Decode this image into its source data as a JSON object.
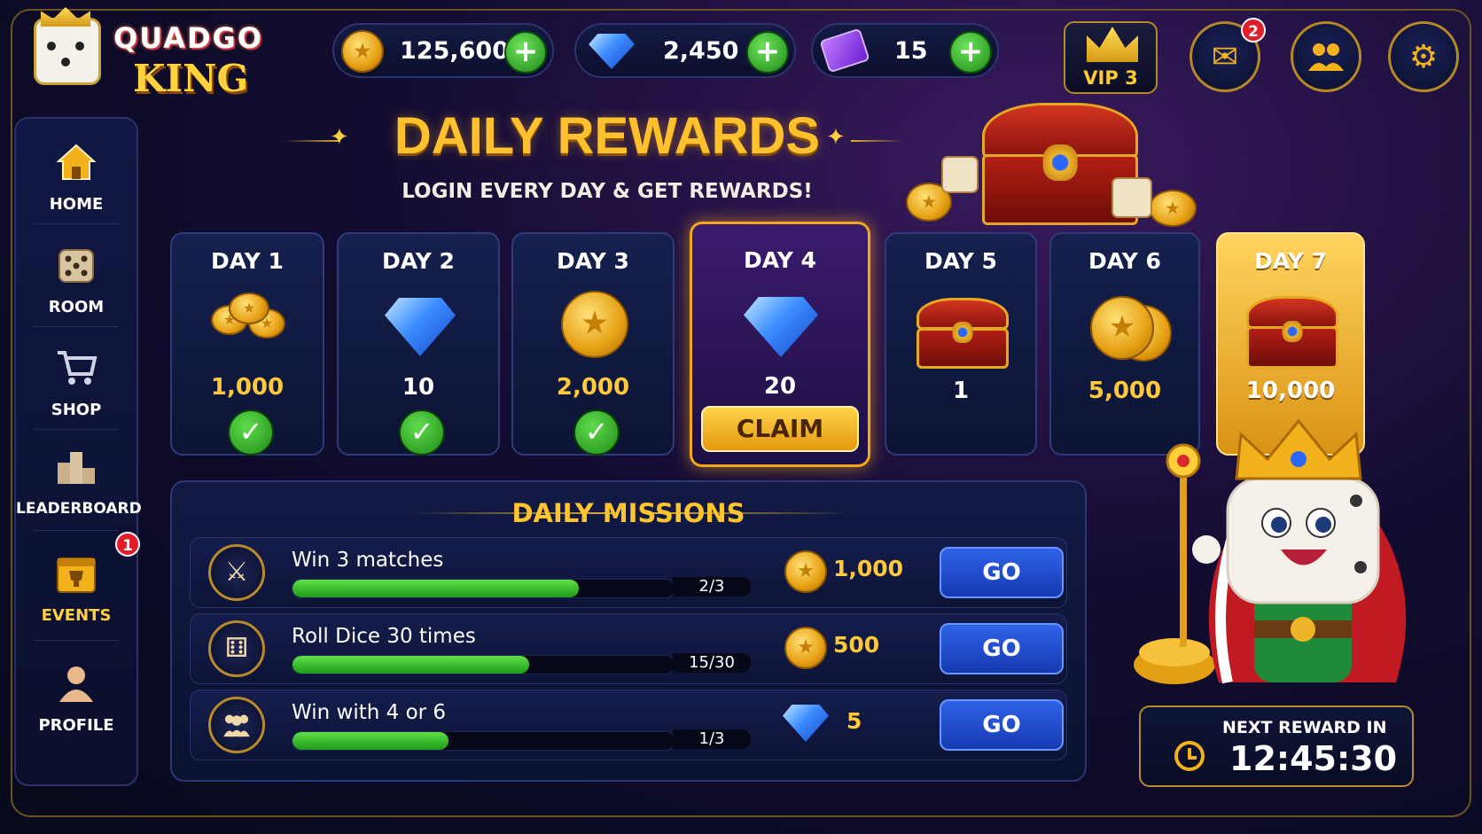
{
  "app": {
    "logo_line1": "QUADGO",
    "logo_line2": "KING"
  },
  "resources": {
    "coins": "125,600",
    "gems": "2,450",
    "tickets": "15"
  },
  "vip": {
    "label": "VIP 3"
  },
  "mail": {
    "badge": "2"
  },
  "sidebar": {
    "items": [
      {
        "label": "HOME",
        "icon": "home-icon"
      },
      {
        "label": "ROOM",
        "icon": "dice-icon"
      },
      {
        "label": "SHOP",
        "icon": "cart-icon"
      },
      {
        "label": "LEADERBOARD",
        "icon": "podium-icon"
      },
      {
        "label": "EVENTS",
        "icon": "calendar-trophy-icon",
        "badge": "1"
      },
      {
        "label": "PROFILE",
        "icon": "person-icon"
      }
    ]
  },
  "header": {
    "title": "DAILY REWARDS",
    "subtitle": "LOGIN EVERY DAY & GET REWARDS!"
  },
  "days": [
    {
      "label": "DAY 1",
      "reward": "1,000",
      "reward_type": "coins",
      "status": "claimed"
    },
    {
      "label": "DAY 2",
      "reward": "10",
      "reward_type": "gem",
      "status": "claimed"
    },
    {
      "label": "DAY 3",
      "reward": "2,000",
      "reward_type": "coin",
      "status": "claimed"
    },
    {
      "label": "DAY 4",
      "reward": "20",
      "reward_type": "gem",
      "status": "current",
      "button": "CLAIM"
    },
    {
      "label": "DAY 5",
      "reward": "1",
      "reward_type": "chest",
      "status": "locked"
    },
    {
      "label": "DAY 6",
      "reward": "5,000",
      "reward_type": "coins",
      "status": "locked"
    },
    {
      "label": "DAY 7",
      "reward": "10,000",
      "reward_type": "chest",
      "status": "bonus"
    }
  ],
  "missions": {
    "title": "DAILY MISSIONS",
    "items": [
      {
        "name": "Win 3 matches",
        "progress": "2/3",
        "fraction": 0.75,
        "reward": "1,000",
        "reward_type": "coin",
        "icon": "crossed-swords-icon",
        "button": "GO"
      },
      {
        "name": "Roll Dice 30 times",
        "progress": "15/30",
        "fraction": 0.62,
        "reward": "500",
        "reward_type": "coin",
        "icon": "dice-icon",
        "button": "GO"
      },
      {
        "name": "Win with 4 or 6",
        "progress": "1/3",
        "fraction": 0.41,
        "reward": "5",
        "reward_type": "gem",
        "icon": "group-icon",
        "button": "GO"
      }
    ]
  },
  "timer": {
    "label": "NEXT REWARD IN",
    "value": "12:45:30"
  },
  "colors": {
    "accent_gold": "#ffc22e",
    "go_blue": "#2f62e8",
    "progress_green": "#3fc52f"
  }
}
